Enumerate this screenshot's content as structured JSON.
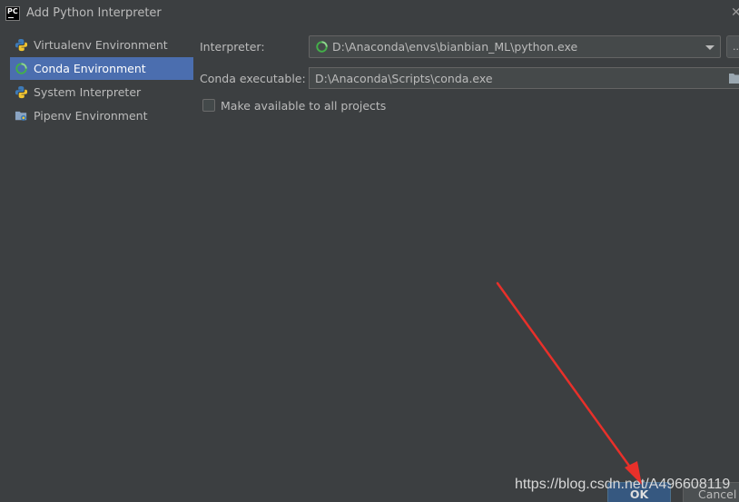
{
  "window": {
    "title": "Add Python Interpreter",
    "logo_text": "PC",
    "close_glyph": "✕"
  },
  "sidebar": {
    "items": [
      {
        "label": "Virtualenv Environment",
        "icon": "python-icon",
        "selected": false
      },
      {
        "label": "Conda Environment",
        "icon": "conda-icon",
        "selected": true
      },
      {
        "label": "System Interpreter",
        "icon": "python-icon",
        "selected": false
      },
      {
        "label": "Pipenv Environment",
        "icon": "pipenv-icon",
        "selected": false
      }
    ]
  },
  "form": {
    "interpreter_label": "Interpreter:",
    "interpreter_value": "D:\\Anaconda\\envs\\bianbian_ML\\python.exe",
    "more_button_label": "...",
    "conda_label": "Conda executable:",
    "conda_value": "D:\\Anaconda\\Scripts\\conda.exe",
    "make_available_label": "Make available to all projects",
    "make_available_checked": false
  },
  "buttons": {
    "ok_label": "OK",
    "cancel_label": "Cancel"
  },
  "watermark": "https://blog.csdn.net/A496608119",
  "colors": {
    "background": "#3c3f41",
    "selection": "#4b6eaf",
    "ok_button": "#365880",
    "annotation_arrow": "#e8302a"
  }
}
